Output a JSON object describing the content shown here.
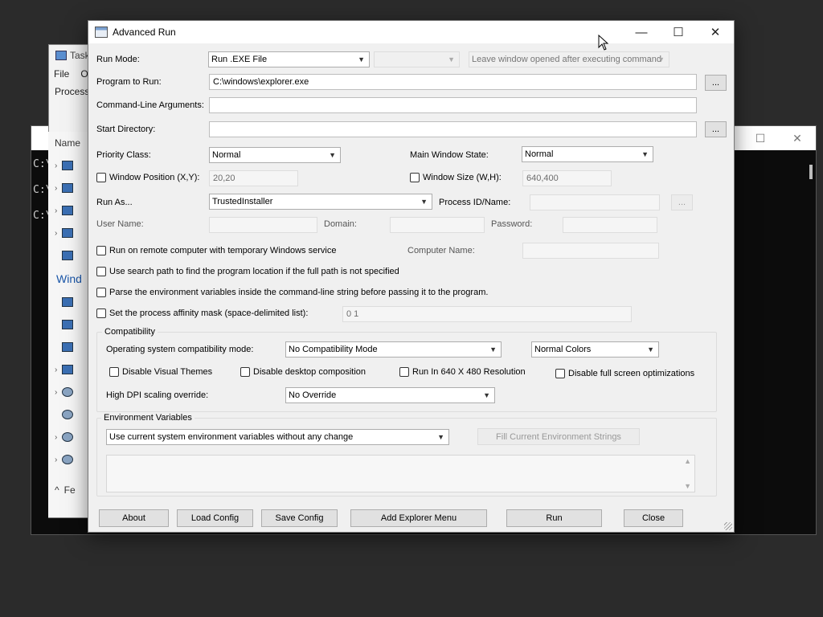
{
  "bg_windows": {
    "taskmgr": {
      "title": "Task",
      "menu": [
        "File",
        "O"
      ],
      "tab": "Process",
      "name_header": "Name",
      "section": "Wind",
      "footer": "Fe"
    },
    "cmd": {
      "lines": [
        "C:\\",
        "C:\\",
        "C:\\"
      ]
    }
  },
  "window": {
    "title": "Advanced Run",
    "minimize_label": "—",
    "maximize_label": "☐",
    "close_label": "✕"
  },
  "form": {
    "run_mode": {
      "label": "Run Mode:",
      "value": "Run .EXE File",
      "sub_value": "",
      "after_exec": "Leave window opened after executing command"
    },
    "program": {
      "label": "Program to Run:",
      "value": "C:\\windows\\explorer.exe",
      "browse": "..."
    },
    "args": {
      "label": "Command-Line Arguments:",
      "value": ""
    },
    "start_dir": {
      "label": "Start Directory:",
      "value": "",
      "browse": "..."
    },
    "priority": {
      "label": "Priority Class:",
      "value": "Normal"
    },
    "main_state": {
      "label": "Main Window State:",
      "value": "Normal"
    },
    "window_pos": {
      "label": "Window Position (X,Y):",
      "value": "20,20"
    },
    "window_size": {
      "label": "Window Size (W,H):",
      "value": "640,400"
    },
    "run_as": {
      "label": "Run As...",
      "value": "TrustedInstaller"
    },
    "process_id": {
      "label": "Process ID/Name:",
      "value": "",
      "browse": "..."
    },
    "user_name": {
      "label": "User Name:",
      "value": ""
    },
    "domain": {
      "label": "Domain:",
      "value": ""
    },
    "password": {
      "label": "Password:",
      "value": ""
    },
    "remote": {
      "label": "Run on remote computer with temporary Windows service",
      "computer_label": "Computer Name:",
      "computer_value": ""
    },
    "search_path": {
      "label": "Use search path to find the program location if the full path is not specified"
    },
    "parse_env": {
      "label": "Parse the environment variables inside the command-line string before passing it to the program."
    },
    "affinity": {
      "label": "Set the process affinity mask (space-delimited list):",
      "value": "0 1"
    }
  },
  "compat": {
    "title": "Compatibility",
    "os_label": "Operating system compatibility mode:",
    "os_value": "No Compatibility Mode",
    "colors_value": "Normal Colors",
    "visual_themes": "Disable Visual Themes",
    "desktop_comp": "Disable desktop composition",
    "res_640": "Run In 640 X 480 Resolution",
    "fullscreen": "Disable full screen optimizations",
    "dpi_label": "High DPI scaling override:",
    "dpi_value": "No Override"
  },
  "env": {
    "title": "Environment Variables",
    "mode_value": "Use current system environment variables without any change",
    "fill_button": "Fill Current Environment Strings"
  },
  "buttons": {
    "about": "About",
    "load": "Load Config",
    "save": "Save Config",
    "explorer_menu": "Add Explorer Menu",
    "run": "Run",
    "close": "Close"
  }
}
